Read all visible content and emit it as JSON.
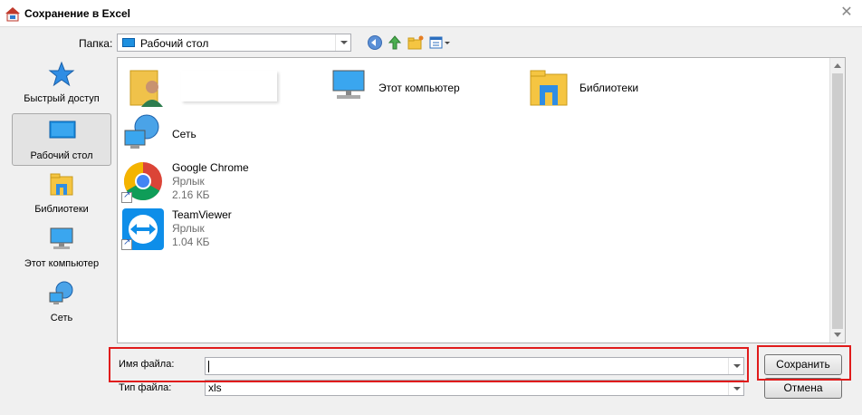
{
  "window": {
    "title": "Сохранение в Excel"
  },
  "toolbar": {
    "folder_label": "Папка:",
    "folder_value": "Рабочий стол"
  },
  "places": [
    {
      "label": "Быстрый доступ"
    },
    {
      "label": "Рабочий стол"
    },
    {
      "label": "Библиотеки"
    },
    {
      "label": "Этот компьютер"
    },
    {
      "label": "Сеть"
    }
  ],
  "files": {
    "user_folder": {
      "name": ""
    },
    "this_pc": {
      "name": "Этот компьютер"
    },
    "libraries": {
      "name": "Библиотеки"
    },
    "network": {
      "name": "Сеть"
    },
    "chrome": {
      "name": "Google Chrome",
      "type": "Ярлык",
      "size": "2.16 КБ"
    },
    "teamviewer": {
      "name": "TeamViewer",
      "type": "Ярлык",
      "size": "1.04 КБ"
    }
  },
  "bottom": {
    "filename_label": "Имя файла:",
    "filename_value": "",
    "filetype_label": "Тип файла:",
    "filetype_value": "xls",
    "save_label": "Сохранить",
    "cancel_label": "Отмена"
  },
  "colors": {
    "highlight": "#e01b1b",
    "folder_blue": "#1e90e0",
    "folder_yellow": "#f5c542"
  }
}
